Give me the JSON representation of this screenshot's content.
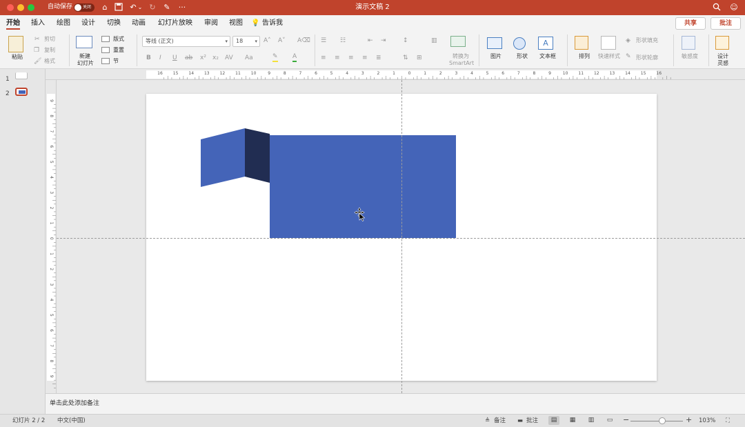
{
  "titlebar": {
    "autosave_label": "自动保存",
    "toggle_label": "关闭",
    "doc_title": "演示文稿 2",
    "more": "···",
    "window_colors": {
      "close": "#fe5f57",
      "minimize": "#febc2e",
      "zoom": "#28c840"
    }
  },
  "tabs": {
    "items": [
      "开始",
      "插入",
      "绘图",
      "设计",
      "切换",
      "动画",
      "幻灯片放映",
      "审阅",
      "视图"
    ],
    "tell_me": "告诉我",
    "share": "共享",
    "comments": "批注"
  },
  "ribbon": {
    "paste": "粘贴",
    "cut": "剪切",
    "copy": "复制",
    "format": "格式",
    "new_slide_1": "新建",
    "new_slide_2": "幻灯片",
    "layout": "版式",
    "reset": "重置",
    "section": "节",
    "font_name": "等线 (正文)",
    "font_size": "18",
    "convert_smartart_1": "转换为",
    "convert_smartart_2": "SmartArt",
    "picture": "图片",
    "shape": "形状",
    "textbox": "文本框",
    "arrange": "排列",
    "quick_styles": "快速样式",
    "shape_fill": "形状填充",
    "shape_outline": "形状轮廓",
    "sensitivity": "敏感度",
    "design_ideas_1": "设计",
    "design_ideas_2": "灵感"
  },
  "thumbnails": [
    {
      "number": "1"
    },
    {
      "number": "2"
    }
  ],
  "ruler_h": [
    "16",
    "15",
    "14",
    "13",
    "12",
    "11",
    "10",
    "9",
    "8",
    "7",
    "6",
    "5",
    "4",
    "3",
    "2",
    "1",
    "0",
    "1",
    "2",
    "3",
    "4",
    "5",
    "6",
    "7",
    "8",
    "9",
    "10",
    "11",
    "12",
    "13",
    "14",
    "15",
    "16"
  ],
  "ruler_v": [
    "9",
    "8",
    "7",
    "6",
    "5",
    "4",
    "3",
    "2",
    "1",
    "0",
    "1",
    "2",
    "3",
    "4",
    "5",
    "6",
    "7",
    "8",
    "9"
  ],
  "slide": {
    "colors": {
      "main": "#4464b8",
      "dark": "#212d52",
      "accent": "#c0432c"
    }
  },
  "notes": "单击此处添加备注",
  "status": {
    "slide_info": "幻灯片 2 / 2",
    "language": "中文(中国)",
    "notes": "备注",
    "comments": "批注",
    "zoom": "103%",
    "zoom_level": 0.6
  }
}
